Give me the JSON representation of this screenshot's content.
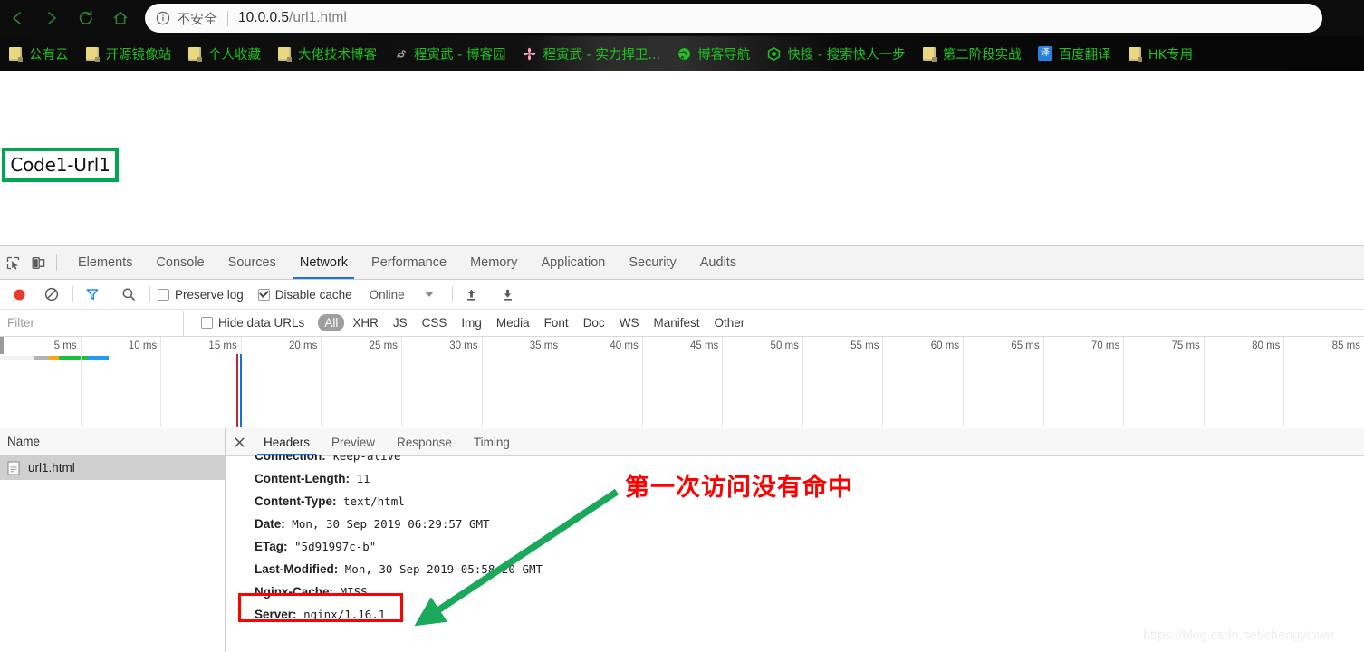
{
  "browser": {
    "nav": {
      "back": "back-arrow",
      "forward": "forward-arrow",
      "reload": "reload-arrow",
      "home": "home-house"
    },
    "omnibox": {
      "info_icon": "info-circle-icon",
      "security_label": "不安全",
      "url_host": "10.0.0.5",
      "url_path": "/url1.html"
    },
    "bookmarks": [
      {
        "label": "公有云",
        "icon": "folder-icon"
      },
      {
        "label": "开源镜像站",
        "icon": "folder-icon"
      },
      {
        "label": "个人收藏",
        "icon": "folder-icon"
      },
      {
        "label": "大佬技术博客",
        "icon": "folder-icon"
      },
      {
        "label": "程寅武 - 博客园",
        "icon": "site-favicon"
      },
      {
        "label": "程寅武 - 实力捍卫...",
        "icon": "flower-favicon"
      },
      {
        "label": "博客导航",
        "icon": "globe-favicon"
      },
      {
        "label": "快搜 - 搜索快人一步",
        "icon": "search-favicon"
      },
      {
        "label": "第二阶段实战",
        "icon": "folder-icon"
      },
      {
        "label": "百度翻译",
        "icon": "translate-icon"
      },
      {
        "label": "HK专用",
        "icon": "folder-icon"
      }
    ]
  },
  "page": {
    "annotation_box_label": "Code1-Url1"
  },
  "devtools": {
    "tools": {
      "inspect": "inspect-cursor-icon",
      "device": "device-toolbar-icon"
    },
    "tabs": [
      {
        "label": "Elements",
        "active": false
      },
      {
        "label": "Console",
        "active": false
      },
      {
        "label": "Sources",
        "active": false
      },
      {
        "label": "Network",
        "active": true
      },
      {
        "label": "Performance",
        "active": false
      },
      {
        "label": "Memory",
        "active": false
      },
      {
        "label": "Application",
        "active": false
      },
      {
        "label": "Security",
        "active": false
      },
      {
        "label": "Audits",
        "active": false
      }
    ],
    "toolbar": {
      "record_icon": "record-circle-icon",
      "clear_icon": "clear-no-entry-icon",
      "filter_icon": "filter-funnel-icon",
      "search_icon": "search-magnifier-icon",
      "preserve_log_label": "Preserve log",
      "preserve_log_checked": false,
      "disable_cache_label": "Disable cache",
      "disable_cache_checked": true,
      "throttling_value": "Online",
      "import_icon": "upload-arrow-icon",
      "export_icon": "download-arrow-icon"
    },
    "filter": {
      "input_value": "",
      "input_placeholder": "Filter",
      "hide_data_urls_label": "Hide data URLs",
      "hide_data_urls_checked": false,
      "types": [
        "All",
        "XHR",
        "JS",
        "CSS",
        "Img",
        "Media",
        "Font",
        "Doc",
        "WS",
        "Manifest",
        "Other"
      ],
      "selected_type": "All"
    },
    "overview": {
      "ticks": [
        "5 ms",
        "10 ms",
        "15 ms",
        "20 ms",
        "25 ms",
        "30 ms",
        "35 ms",
        "40 ms",
        "45 ms",
        "50 ms",
        "55 ms",
        "60 ms",
        "65 ms",
        "70 ms",
        "75 ms",
        "80 ms",
        "85 ms"
      ],
      "bar_segments": [
        {
          "color": "#f0f0f0",
          "width": 38
        },
        {
          "color": "#b3b3b3",
          "width": 16
        },
        {
          "color": "#ffa217",
          "width": 11
        },
        {
          "color": "#1bbf3b",
          "width": 32
        },
        {
          "color": "#1f9df5",
          "width": 23
        }
      ],
      "dom_content_loaded_color": "#b82e2e",
      "load_event_color": "#1a6fe0"
    },
    "requests": {
      "column_header": "Name",
      "rows": [
        {
          "name": "url1.html",
          "icon": "document-icon",
          "selected": true
        }
      ]
    },
    "details": {
      "close_icon": "close-x-icon",
      "tabs": [
        {
          "label": "Headers",
          "active": true
        },
        {
          "label": "Preview",
          "active": false
        },
        {
          "label": "Response",
          "active": false
        },
        {
          "label": "Timing",
          "active": false
        }
      ],
      "headers": [
        {
          "name": "Connection:",
          "value": "keep-alive"
        },
        {
          "name": "Content-Length:",
          "value": "11"
        },
        {
          "name": "Content-Type:",
          "value": "text/html"
        },
        {
          "name": "Date:",
          "value": "Mon, 30 Sep 2019 06:29:57 GMT"
        },
        {
          "name": "ETag:",
          "value": "\"5d91997c-b\""
        },
        {
          "name": "Last-Modified:",
          "value": "Mon, 30 Sep 2019 05:58:20 GMT"
        },
        {
          "name": "Nginx-Cache:",
          "value": "MISS"
        },
        {
          "name": "Server:",
          "value": "nginx/1.16.1"
        }
      ]
    }
  },
  "annotations": {
    "red_note": "第一次访问没有命中",
    "red_note_color": "#ff0000",
    "green_box_color": "#00a651",
    "red_box_color": "#ff0000",
    "arrow_color": "#1aa85a",
    "watermark": "https://blog.csdn.net/chengyinwu"
  }
}
